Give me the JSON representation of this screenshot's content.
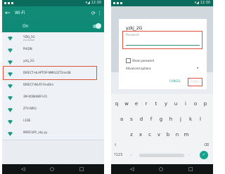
{
  "left": {
    "status_right": "▾◢ 12:30",
    "title": "Wi-Fi",
    "toggle_label": "On",
    "networks": [
      {
        "ssid": "YZKJ_5G",
        "sub": "Connected"
      },
      {
        "ssid": "PUQIN",
        "sub": ""
      },
      {
        "ssid": "yzkj_2G",
        "sub": ""
      },
      {
        "ssid": "DIRECT-HLAPTOP-NMIU22T2msSB",
        "sub": ""
      },
      {
        "ssid": "DIRECT-WLAT-FineDm",
        "sub": ""
      },
      {
        "ssid": "3M-ROBHWIFI-01",
        "sub": ""
      },
      {
        "ssid": "ZTV-WRG",
        "sub": ""
      },
      {
        "ssid": "L1DE",
        "sub": ""
      },
      {
        "ssid": "MERCURY_xky-yy",
        "sub": ""
      }
    ],
    "highlight_index": 2
  },
  "right": {
    "status_right": "▾◢ 12:30",
    "dialog_title": "yzkj_2G",
    "password_label": "Password",
    "show_password": "Show password",
    "advanced": "Advanced options",
    "cancel": "CANCEL",
    "connect": "CONNECT"
  },
  "keyboard": {
    "row1": [
      "q",
      "w",
      "e",
      "r",
      "t",
      "y",
      "u",
      "i",
      "o",
      "p"
    ],
    "row2": [
      "a",
      "s",
      "d",
      "f",
      "g",
      "h",
      "j",
      "k",
      "l"
    ],
    "row3": [
      "z",
      "x",
      "c",
      "v",
      "b",
      "n",
      "m"
    ],
    "shift": "⇧",
    "backspace": "⌫",
    "symbols": "?123",
    "comma": ",",
    "period": ".",
    "enter": "✓"
  },
  "nav": {
    "back": "◁",
    "home": "○",
    "recent": "□"
  },
  "colors": {
    "accent": "#118a76",
    "highlight": "#e0533d"
  }
}
